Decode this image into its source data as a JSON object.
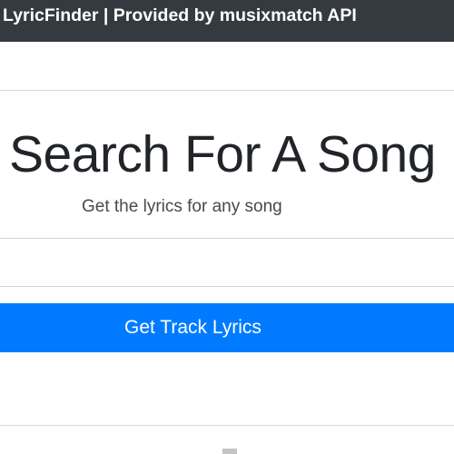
{
  "navbar": {
    "brand": "LyricFinder | Provided by musixmatch API"
  },
  "search": {
    "title": "Search For A Song",
    "subtitle": "Get the lyrics for any song",
    "input_value": "",
    "input_placeholder": "",
    "submit_label": "Get Track Lyrics"
  },
  "colors": {
    "navbar_bg": "#343a40",
    "button_bg": "#007bff",
    "divider": "#d7d7d7"
  }
}
